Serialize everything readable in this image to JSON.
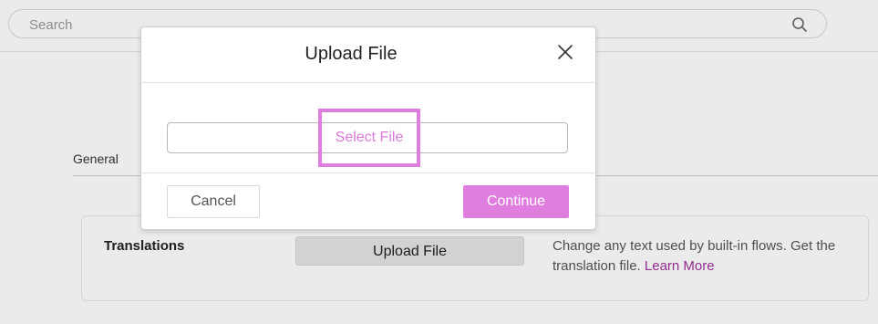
{
  "search": {
    "placeholder": "Search"
  },
  "tabs": [
    {
      "label": "General"
    }
  ],
  "card": {
    "title": "Translations",
    "button_label": "Upload File",
    "description": "Change any text used by built-in flows. Get the translation file.",
    "link_label": "Learn More"
  },
  "modal": {
    "title": "Upload File",
    "select_file_label": "Select File",
    "cancel_label": "Cancel",
    "continue_label": "Continue"
  },
  "colors": {
    "accent": "#e07ee0",
    "link": "#a0309a"
  },
  "icons": {
    "search": "search-icon",
    "close": "close-icon"
  }
}
